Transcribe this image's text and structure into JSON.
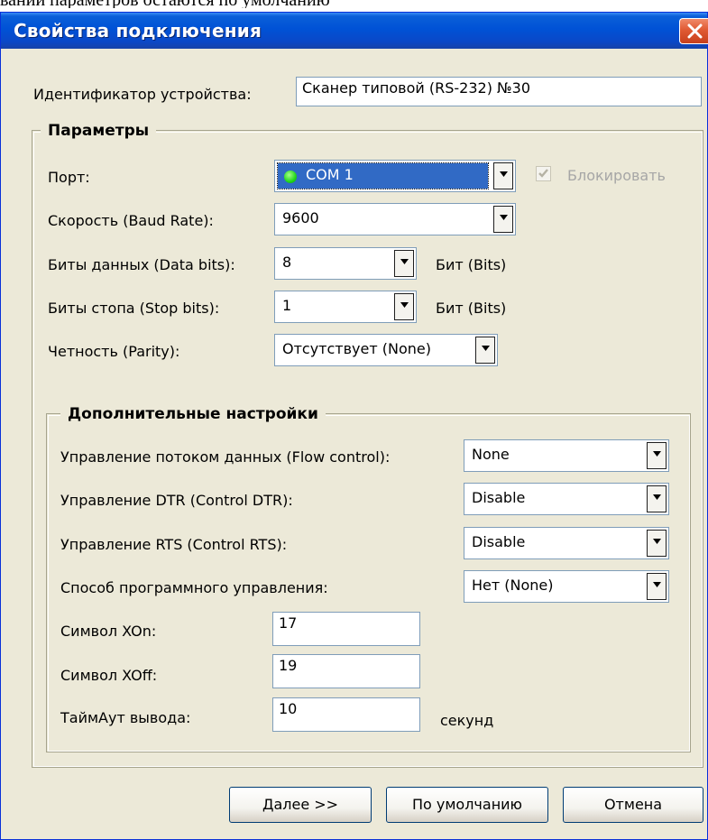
{
  "page": {
    "top_text": "ваний параметров остаются по умолчанию"
  },
  "window": {
    "title": "Свойства подключения"
  },
  "device": {
    "label": "Идентификатор устройства:",
    "value": "Сканер типовой (RS-232) №30"
  },
  "params": {
    "title": "Параметры",
    "port_label": "Порт:",
    "port_value": "COM 1",
    "lock_label": "Блокировать",
    "baud_label": "Скорость (Baud Rate):",
    "baud_value": "9600",
    "data_bits_label": "Биты данных (Data bits):",
    "data_bits_value": "8",
    "data_bits_unit": "Бит (Bits)",
    "stop_bits_label": "Биты стопа (Stop bits):",
    "stop_bits_value": "1",
    "stop_bits_unit": "Бит (Bits)",
    "parity_label": "Четность (Parity):",
    "parity_value": "Отсутствует (None)"
  },
  "advanced": {
    "title": "Дополнительные настройки",
    "flow_label": "Управление потоком данных (Flow control):",
    "flow_value": "None",
    "dtr_label": "Управление DTR (Control DTR):",
    "dtr_value": "Disable",
    "rts_label": "Управление RTS (Control RTS):",
    "rts_value": "Disable",
    "soft_label": "Способ программного управления:",
    "soft_value": "Нет (None)",
    "xon_label": "Символ XOn:",
    "xon_value": "17",
    "xoff_label": "Символ XOff:",
    "xoff_value": "19",
    "timeout_label": "ТаймАут вывода:",
    "timeout_value": "10",
    "timeout_unit": "секунд"
  },
  "buttons": {
    "next": "Далее >>",
    "default": "По умолчанию",
    "cancel": "Отмена"
  },
  "states": {
    "lock_checked": true,
    "lock_disabled": true
  },
  "colors": {
    "titlebar": "#0052d6",
    "selection": "#316ac5",
    "port_status": "#22d61a",
    "dialog_bg": "#ece9d8"
  },
  "icons": {
    "close": "close-icon",
    "dropdown": "chevron-down-icon",
    "status": "status-dot-icon",
    "check": "check-icon"
  }
}
